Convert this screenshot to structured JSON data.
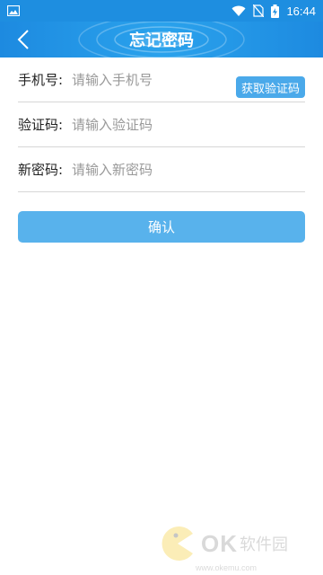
{
  "status_bar": {
    "time": "16:44",
    "icons": [
      "image-icon",
      "wifi-icon",
      "no-sim-icon",
      "battery-charging-icon"
    ]
  },
  "app_bar": {
    "title": "忘记密码",
    "back_icon": "chevron-left-icon"
  },
  "form": {
    "phone": {
      "label": "手机号:",
      "placeholder": "请输入手机号",
      "value": ""
    },
    "get_code_button": "获取验证码",
    "code": {
      "label": "验证码:",
      "placeholder": "请输入验证码",
      "value": ""
    },
    "new_password": {
      "label": "新密码:",
      "placeholder": "请输入新密码",
      "value": ""
    }
  },
  "confirm_button": "确认",
  "watermark": {
    "logo_text": "OK",
    "cn_text": "软件园",
    "url": "www.okemu.com"
  },
  "colors": {
    "primary": "#1e8ee0",
    "button": "#58b2ec",
    "code_button": "#4aa9ea"
  }
}
